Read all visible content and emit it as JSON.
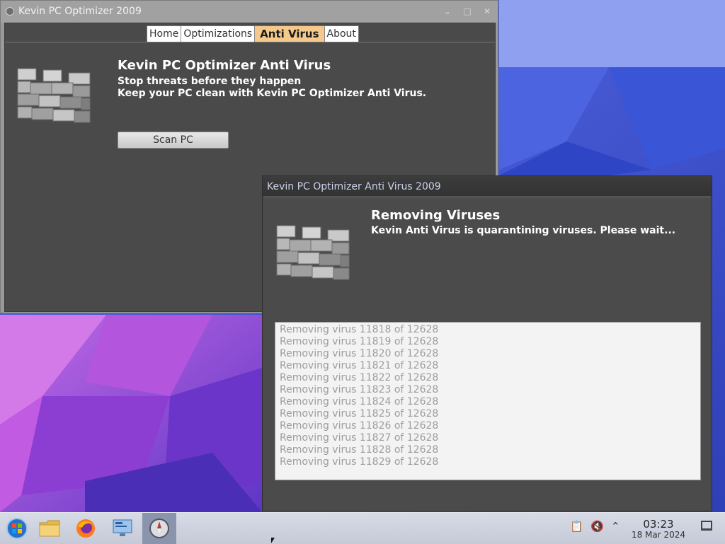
{
  "main_window": {
    "title": "Kevin PC Optimizer 2009",
    "tabs": [
      "Home",
      "Optimizations",
      "Anti Virus",
      "About"
    ],
    "active_tab": "Anti Virus",
    "heading": "Kevin PC Optimizer Anti Virus",
    "subtitle_1": "Stop threats before they happen",
    "subtitle_2": "Keep your PC clean with Kevin PC Optimizer Anti Virus.",
    "scan_button": "Scan PC"
  },
  "popup_window": {
    "title": "Kevin PC Optimizer Anti Virus 2009",
    "heading": "Removing Viruses",
    "subtitle": "Kevin Anti Virus is quarantining viruses. Please wait...",
    "log": [
      "Removing virus 11818 of 12628",
      "Removing virus 11819 of 12628",
      "Removing virus 11820 of 12628",
      "Removing virus 11821 of 12628",
      "Removing virus 11822 of 12628",
      "Removing virus 11823 of 12628",
      "Removing virus 11824 of 12628",
      "Removing virus 11825 of 12628",
      "Removing virus 11826 of 12628",
      "Removing virus 11827 of 12628",
      "Removing virus 11828 of 12628",
      "Removing virus 11829 of 12628"
    ]
  },
  "taskbar": {
    "items": [
      "start-orb-icon",
      "file-manager-icon",
      "firefox-icon",
      "remote-desktop-icon",
      "safari-compass-icon"
    ],
    "active_item": "safari-compass-icon",
    "tray_icons": [
      "clipboard-icon",
      "volume-muted-icon",
      "chevron-up-icon"
    ],
    "time": "03:23",
    "date": "18 Mar 2024",
    "show_desktop": "show-desktop-icon"
  },
  "colors": {
    "wallpaper_blue": "#3f55d4",
    "wallpaper_purple": "#9b3fd0",
    "active_tab": "#f5c98b",
    "window_body": "#4a4a4a"
  }
}
